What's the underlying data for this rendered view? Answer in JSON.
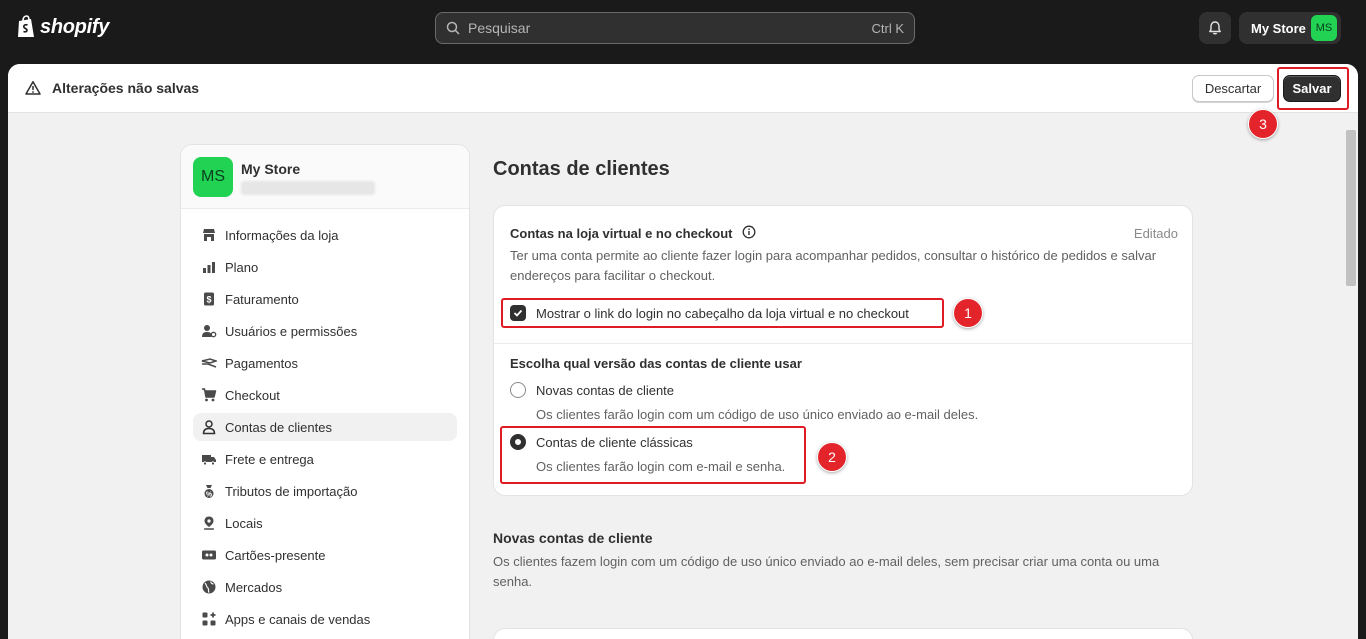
{
  "topbar": {
    "brand": "shopify",
    "search_placeholder": "Pesquisar",
    "search_shortcut": "Ctrl K",
    "store_label": "My Store",
    "store_initials": "MS"
  },
  "savebar": {
    "title": "Alterações não salvas",
    "discard_label": "Descartar",
    "save_label": "Salvar"
  },
  "sidebar": {
    "store_name": "My Store",
    "store_initials": "MS",
    "items": [
      {
        "label": "Informações da loja",
        "icon": "store-icon"
      },
      {
        "label": "Plano",
        "icon": "plan-icon"
      },
      {
        "label": "Faturamento",
        "icon": "billing-icon"
      },
      {
        "label": "Usuários e permissões",
        "icon": "users-icon"
      },
      {
        "label": "Pagamentos",
        "icon": "payments-icon"
      },
      {
        "label": "Checkout",
        "icon": "cart-icon"
      },
      {
        "label": "Contas de clientes",
        "icon": "person-icon"
      },
      {
        "label": "Frete e entrega",
        "icon": "truck-icon"
      },
      {
        "label": "Tributos de importação",
        "icon": "duties-icon"
      },
      {
        "label": "Locais",
        "icon": "location-icon"
      },
      {
        "label": "Cartões-presente",
        "icon": "gift-card-icon"
      },
      {
        "label": "Mercados",
        "icon": "globe-icon"
      },
      {
        "label": "Apps e canais de vendas",
        "icon": "apps-icon"
      }
    ]
  },
  "main": {
    "title": "Contas de clientes",
    "card": {
      "title": "Contas na loja virtual e no checkout",
      "status": "Editado",
      "description": "Ter uma conta permite ao cliente fazer login para acompanhar pedidos, consultar o histórico de pedidos e salvar endereços para facilitar o checkout.",
      "checkbox_label": "Mostrar o link do login no cabeçalho da loja virtual e no checkout",
      "version_title": "Escolha qual versão das contas de cliente usar",
      "options": [
        {
          "label": "Novas contas de cliente",
          "help": "Os clientes farão login com um código de uso único enviado ao e-mail deles."
        },
        {
          "label": "Contas de cliente clássicas",
          "help": "Os clientes farão login com e-mail e senha."
        }
      ]
    },
    "new_accounts": {
      "title": "Novas contas de cliente",
      "description": "Os clientes fazem login com um código de uso único enviado ao e-mail deles, sem precisar criar uma conta ou uma senha."
    }
  },
  "annotations": [
    "1",
    "2",
    "3"
  ],
  "colors": {
    "accent": "#303030",
    "avatar": "#22d353",
    "annotation": "#e3242b"
  }
}
